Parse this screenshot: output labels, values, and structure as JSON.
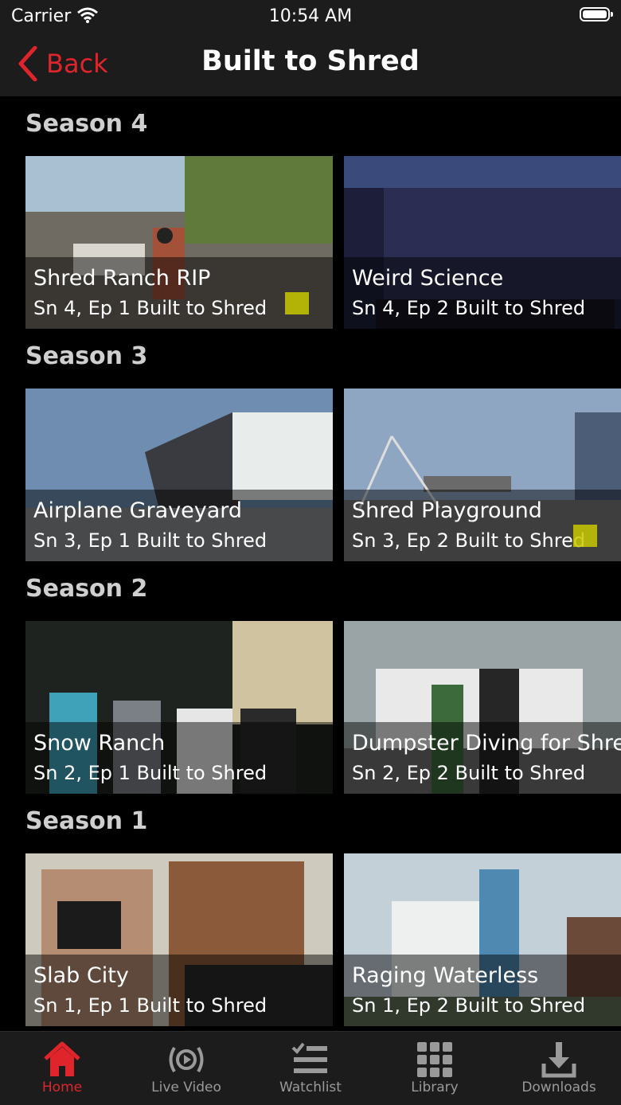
{
  "status_bar": {
    "carrier": "Carrier",
    "time": "10:54 AM"
  },
  "nav": {
    "back_label": "Back",
    "title": "Built to Shred"
  },
  "seasons": [
    {
      "title": "Season 4",
      "episodes": [
        {
          "title": "Shred Ranch RIP",
          "subtitle": "Sn 4, Ep 1 Built to Shred"
        },
        {
          "title": "Weird Science",
          "subtitle": "Sn 4, Ep 2 Built to Shred"
        }
      ]
    },
    {
      "title": "Season 3",
      "episodes": [
        {
          "title": "Airplane Graveyard",
          "subtitle": "Sn 3, Ep 1 Built to Shred"
        },
        {
          "title": "Shred Playground",
          "subtitle": "Sn 3, Ep 2 Built to Shred"
        }
      ]
    },
    {
      "title": "Season 2",
      "episodes": [
        {
          "title": "Snow Ranch",
          "subtitle": "Sn 2, Ep 1 Built to Shred"
        },
        {
          "title": "Dumpster Diving for Shred",
          "subtitle": "Sn 2, Ep 2 Built to Shred"
        }
      ]
    },
    {
      "title": "Season 1",
      "episodes": [
        {
          "title": "Slab City",
          "subtitle": "Sn 1, Ep 1 Built to Shred"
        },
        {
          "title": "Raging Waterless",
          "subtitle": "Sn 1, Ep 2 Built to Shred"
        }
      ]
    }
  ],
  "tabbar": {
    "items": [
      {
        "label": "Home",
        "icon": "home-icon"
      },
      {
        "label": "Live Video",
        "icon": "live-video-icon"
      },
      {
        "label": "Watchlist",
        "icon": "watchlist-icon"
      },
      {
        "label": "Library",
        "icon": "library-icon"
      },
      {
        "label": "Downloads",
        "icon": "downloads-icon"
      }
    ],
    "active_index": 0
  },
  "colors": {
    "accent": "#e0242c",
    "bar_background": "#1c1c1c",
    "inactive": "#9a9a9a"
  }
}
